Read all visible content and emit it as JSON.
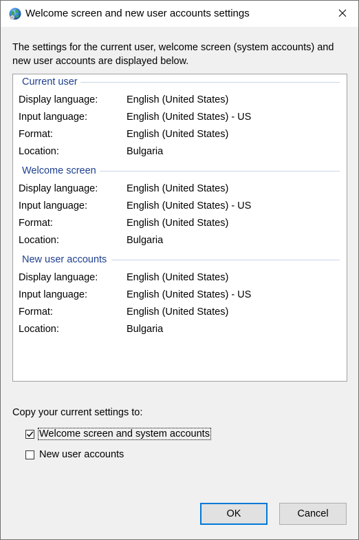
{
  "window": {
    "title": "Welcome screen and new user accounts settings",
    "icon": "globe-icon",
    "close_glyph": "✕"
  },
  "intro_text": "The settings for the current user, welcome screen (system accounts) and new user accounts are displayed below.",
  "sections": [
    {
      "header": "Current user",
      "rows": [
        {
          "label": "Display language:",
          "value": "English (United States)"
        },
        {
          "label": "Input language:",
          "value": "English (United States) - US"
        },
        {
          "label": "Format:",
          "value": "English (United States)"
        },
        {
          "label": "Location:",
          "value": "Bulgaria"
        }
      ]
    },
    {
      "header": "Welcome screen",
      "rows": [
        {
          "label": "Display language:",
          "value": "English (United States)"
        },
        {
          "label": "Input language:",
          "value": "English (United States) - US"
        },
        {
          "label": "Format:",
          "value": "English (United States)"
        },
        {
          "label": "Location:",
          "value": "Bulgaria"
        }
      ]
    },
    {
      "header": "New user accounts",
      "rows": [
        {
          "label": "Display language:",
          "value": "English (United States)"
        },
        {
          "label": "Input language:",
          "value": "English (United States) - US"
        },
        {
          "label": "Format:",
          "value": "English (United States)"
        },
        {
          "label": "Location:",
          "value": "Bulgaria"
        }
      ]
    }
  ],
  "copy": {
    "label": "Copy your current settings to:",
    "options": [
      {
        "label": "Welcome screen and system accounts",
        "checked": true
      },
      {
        "label": "New user accounts",
        "checked": false
      }
    ]
  },
  "buttons": {
    "ok": "OK",
    "cancel": "Cancel"
  },
  "colors": {
    "section_header": "#1e3f8f",
    "ok_border": "#0078d7",
    "dialog_bg": "#f0f0f0"
  }
}
